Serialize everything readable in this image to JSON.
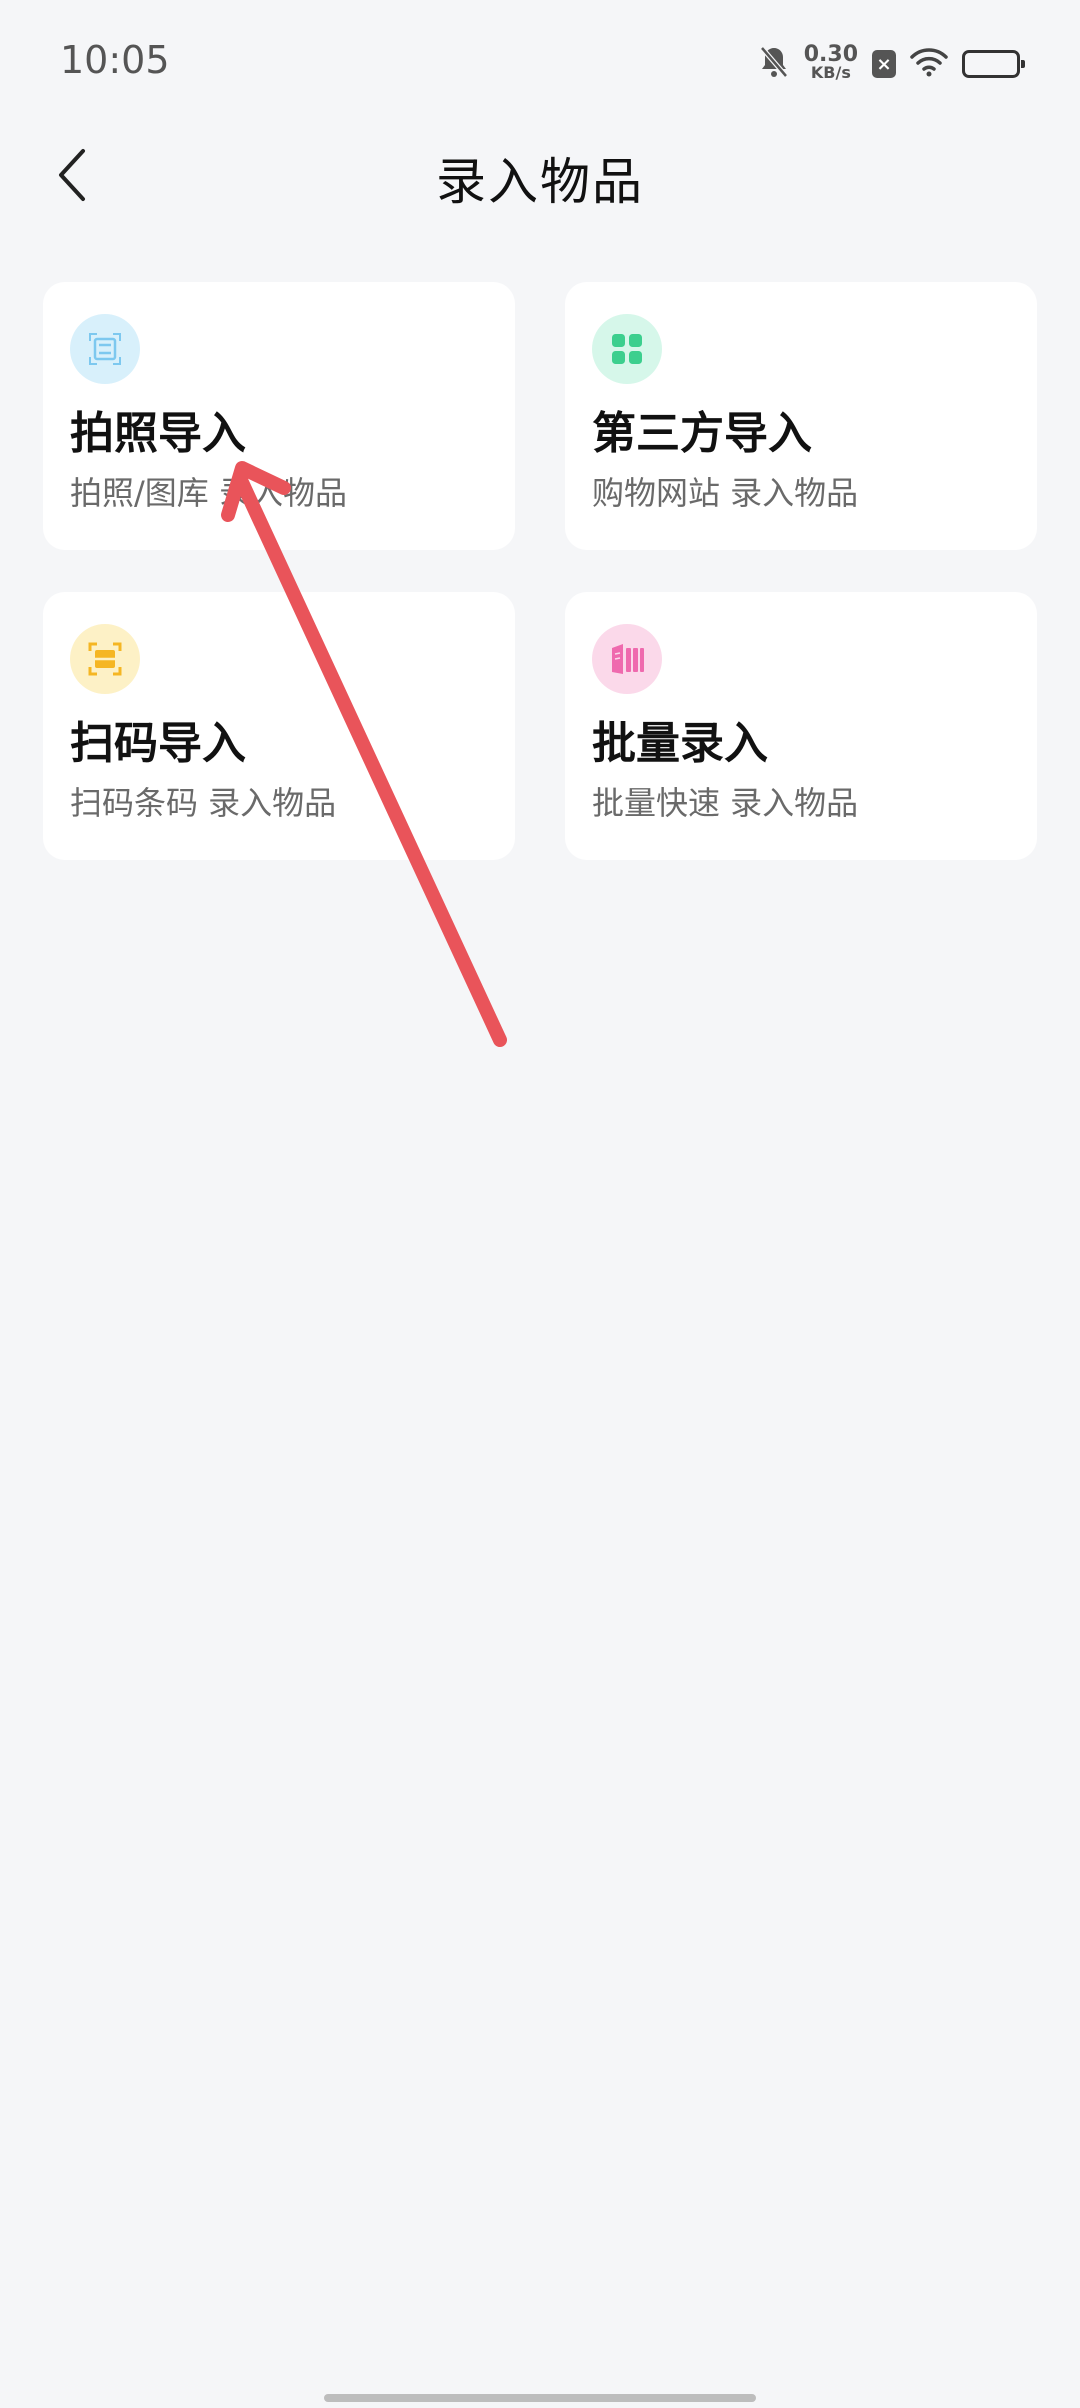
{
  "status_bar": {
    "time": "10:05",
    "speed_value": "0.30",
    "speed_unit": "KB/s",
    "icons": [
      "bell-mute-icon",
      "x-badge-icon",
      "wifi-icon",
      "battery-icon"
    ]
  },
  "header": {
    "back_icon": "chevron-left-icon",
    "title": "录入物品"
  },
  "cards": [
    {
      "title": "拍照导入",
      "subtitle": "拍照/图库 录入物品",
      "icon": "scan-photo-icon",
      "icon_bg": "#d8f0fb",
      "icon_color": "#7dc8ef"
    },
    {
      "title": "第三方导入",
      "subtitle": "购物网站 录入物品",
      "icon": "grid-apps-icon",
      "icon_bg": "#d6f7ea",
      "icon_color": "#3ccf8e"
    },
    {
      "title": "扫码导入",
      "subtitle": "扫码条码 录入物品",
      "icon": "barcode-scan-icon",
      "icon_bg": "#fdf1c6",
      "icon_color": "#f5b623"
    },
    {
      "title": "批量录入",
      "subtitle": "批量快速 录入物品",
      "icon": "batch-books-icon",
      "icon_bg": "#fbd9ea",
      "icon_color": "#ef6aae"
    }
  ],
  "annotation": {
    "arrow_color": "#e9545a"
  }
}
